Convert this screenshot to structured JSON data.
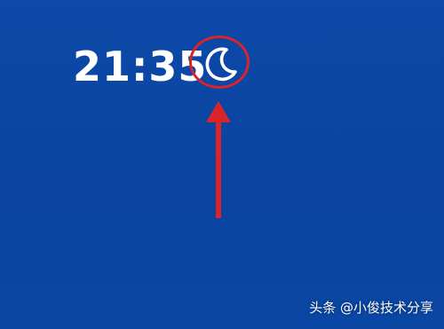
{
  "status_bar": {
    "time": "21:35",
    "do_not_disturb_icon": "crescent-moon-icon"
  },
  "annotation": {
    "highlight_color": "#d9242b",
    "shape": "circle-with-arrow"
  },
  "watermark": {
    "text": "头条 @小俊技术分享"
  },
  "colors": {
    "background": "#0b47a6",
    "text": "#ffffff"
  }
}
